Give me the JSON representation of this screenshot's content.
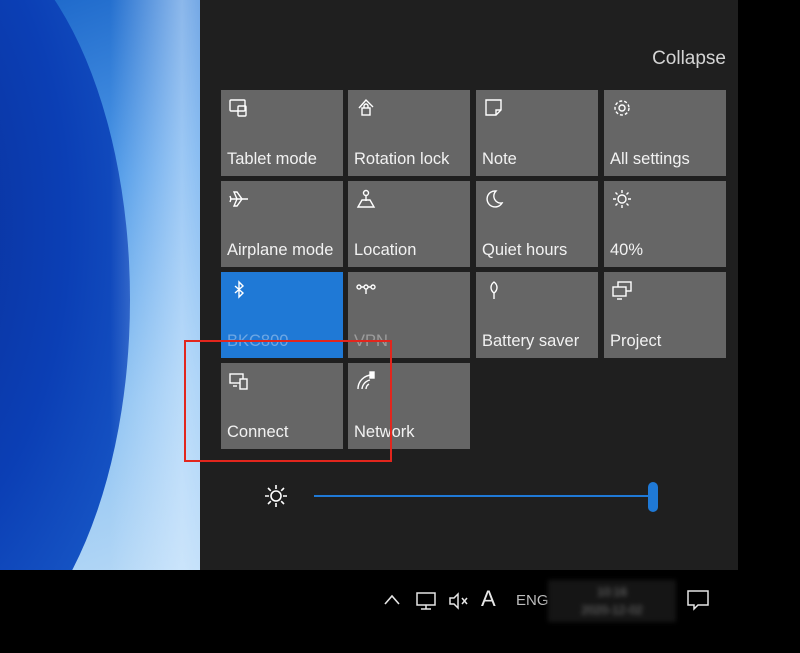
{
  "action_center": {
    "collapse_label": "Collapse",
    "tiles": [
      {
        "label": "Tablet mode",
        "icon": "tablet-mode-icon",
        "active": false
      },
      {
        "label": "Rotation lock",
        "icon": "rotation-lock-icon",
        "active": false
      },
      {
        "label": "Note",
        "icon": "note-icon",
        "active": false
      },
      {
        "label": "All settings",
        "icon": "gear-icon",
        "active": false
      },
      {
        "label": "Airplane mode",
        "icon": "airplane-icon",
        "active": false
      },
      {
        "label": "Location",
        "icon": "location-icon",
        "active": false
      },
      {
        "label": "Quiet hours",
        "icon": "moon-icon",
        "active": false
      },
      {
        "label": "40%",
        "icon": "brightness-icon",
        "active": false
      },
      {
        "label": "BKC800",
        "icon": "bluetooth-icon",
        "active": true
      },
      {
        "label": "VPN",
        "icon": "vpn-icon",
        "active": false
      },
      {
        "label": "Battery saver",
        "icon": "battery-saver-icon",
        "active": false
      },
      {
        "label": "Project",
        "icon": "project-icon",
        "active": false
      },
      {
        "label": "Connect",
        "icon": "connect-icon",
        "active": false
      },
      {
        "label": "Network",
        "icon": "network-icon",
        "active": false
      }
    ],
    "brightness": {
      "icon": "sun-icon",
      "level_fraction": 1.0
    }
  },
  "taskbar": {
    "show_hidden_icon": "chevron-up-icon",
    "network_icon": "network-status-icon",
    "volume_icon": "volume-muted-icon",
    "input_mode_label": "A",
    "language_label": "ENG",
    "clock_time": "10:16",
    "clock_date": "2020-12-02",
    "notifications_icon": "notification-icon"
  },
  "colors": {
    "accent": "#1f79d6",
    "tile": "#666666",
    "panel": "#1f1f1f",
    "highlight_box": "#e2261d"
  }
}
